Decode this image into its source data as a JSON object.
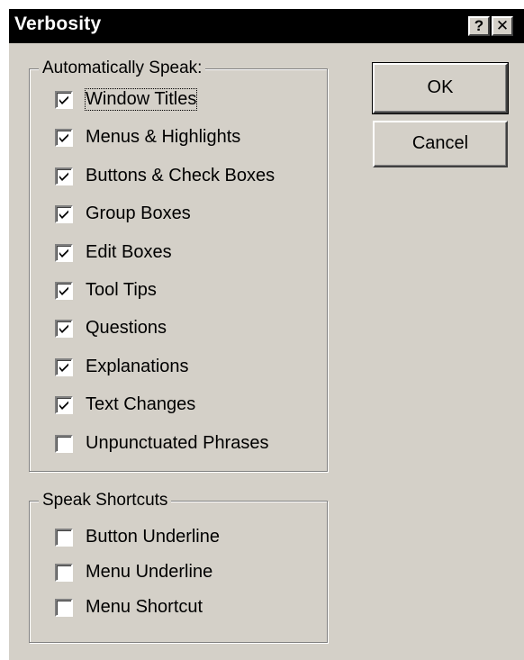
{
  "window": {
    "title": "Verbosity",
    "help_label": "?",
    "close_label": "✕"
  },
  "buttons": {
    "ok_label": "OK",
    "cancel_label": "Cancel"
  },
  "auto_speak": {
    "legend": "Automatically Speak:",
    "items": [
      {
        "label": "Window Titles",
        "checked": true
      },
      {
        "label": "Menus & Highlights",
        "checked": true
      },
      {
        "label": "Buttons & Check Boxes",
        "checked": true
      },
      {
        "label": "Group Boxes",
        "checked": true
      },
      {
        "label": "Edit Boxes",
        "checked": true
      },
      {
        "label": "Tool Tips",
        "checked": true
      },
      {
        "label": "Questions",
        "checked": true
      },
      {
        "label": "Explanations",
        "checked": true
      },
      {
        "label": "Text Changes",
        "checked": true
      },
      {
        "label": "Unpunctuated Phrases",
        "checked": false
      }
    ]
  },
  "speak_shortcuts": {
    "legend": "Speak Shortcuts",
    "items": [
      {
        "label": "Button Underline",
        "checked": false
      },
      {
        "label": "Menu Underline",
        "checked": false
      },
      {
        "label": "Menu Shortcut",
        "checked": false
      }
    ]
  }
}
